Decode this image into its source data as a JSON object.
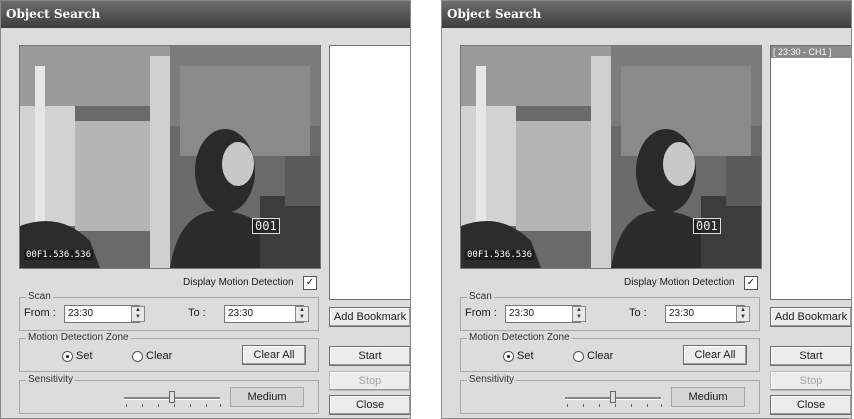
{
  "dialogs": [
    {
      "title": "Object Search",
      "osd_time": "00F1.536.536",
      "osd_channel": "001",
      "list_items": [],
      "display_motion_label": "Display Motion Detection",
      "display_motion_checked": true,
      "scan": {
        "label": "Scan",
        "from_label": "From :",
        "from_value": "23:30",
        "to_label": "To :",
        "to_value": "23:30"
      },
      "motion_zone": {
        "label": "Motion Detection Zone",
        "set_label": "Set",
        "clear_label": "Clear",
        "clear_all_label": "Clear All",
        "selected": "set"
      },
      "sensitivity": {
        "label": "Sensitivity",
        "level": 0.5,
        "value_label": "Medium"
      },
      "buttons": {
        "add_bookmark": "Add Bookmark",
        "start": "Start",
        "stop": "Stop",
        "close": "Close"
      }
    },
    {
      "title": "Object Search",
      "osd_time": "00F1.536.536",
      "osd_channel": "001",
      "list_items": [
        "[ 23:30 - CH1 ]"
      ],
      "display_motion_label": "Display Motion Detection",
      "display_motion_checked": true,
      "scan": {
        "label": "Scan",
        "from_label": "From :",
        "from_value": "23:30",
        "to_label": "To :",
        "to_value": "23:30"
      },
      "motion_zone": {
        "label": "Motion Detection Zone",
        "set_label": "Set",
        "clear_label": "Clear",
        "clear_all_label": "Clear All",
        "selected": "set"
      },
      "sensitivity": {
        "label": "Sensitivity",
        "level": 0.5,
        "value_label": "Medium"
      },
      "buttons": {
        "add_bookmark": "Add Bookmark",
        "start": "Start",
        "stop": "Stop",
        "close": "Close"
      }
    }
  ]
}
